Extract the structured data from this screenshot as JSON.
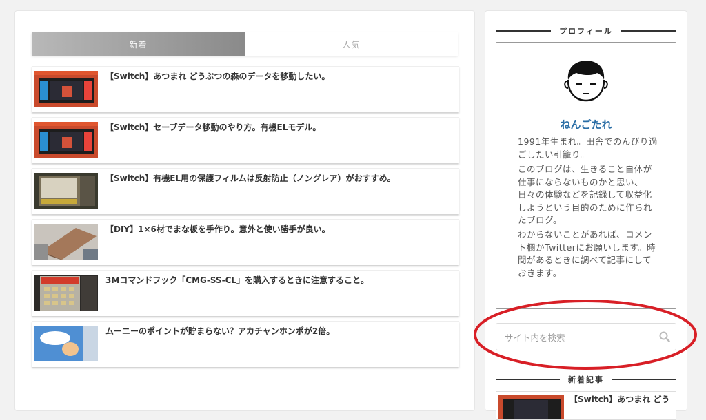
{
  "tabs": [
    {
      "label": "新着",
      "active": true
    },
    {
      "label": "人気",
      "active": false
    }
  ],
  "articles": [
    {
      "title": "【Switch】あつまれ どうぶつの森のデータを移動したい。",
      "thumb": "switch-oled-box"
    },
    {
      "title": "【Switch】セーブデータ移動のやり方。有機ELモデル。",
      "thumb": "switch-oled-box"
    },
    {
      "title": "【Switch】有機EL用の保護フィルムは反射防止（ノングレア）がおすすめ。",
      "thumb": "protective-film"
    },
    {
      "title": "【DIY】1×6材でまな板を手作り。意外と使い勝手が良い。",
      "thumb": "wood-board"
    },
    {
      "title": "3Mコマンドフック「CMG-SS-CL」を購入するときに注意すること。",
      "thumb": "command-hook-pack"
    },
    {
      "title": "ムーニーのポイントが貯まらない？アカチャンホンポが2倍。",
      "thumb": "diaper-pack"
    }
  ],
  "sidebar": {
    "profile_heading": "プロフィール",
    "profile_name": "ねんごたれ",
    "profile_paragraphs": [
      "1991年生まれ。田舎でのんびり過ごしたい引籠り。",
      "このブログは、生きること自体が仕事にならないものかと思い、日々の体験などを記録して収益化しようという目的のために作られたブログ。",
      "わからないことがあれば、コメント欄かTwitterにお願いします。時間があるときに調べて記事にしておきます。"
    ],
    "search_placeholder": "サイト内を検索",
    "recent_heading": "新着記事",
    "recent_first_title": "【Switch】あつまれ どう"
  },
  "colors": {
    "accent_link": "#2a6ea6",
    "annotation": "#d81f26"
  }
}
